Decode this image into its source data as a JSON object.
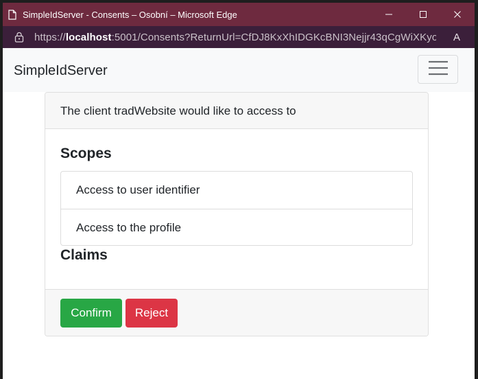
{
  "window": {
    "title": "SimpleIdServer - Consents – Osobní – Microsoft Edge",
    "colors": {
      "titlebar": "#6e2a3f",
      "addressbar": "#3b1f3a"
    }
  },
  "address_bar": {
    "url_prefix": "https://",
    "url_host": "localhost",
    "url_rest": ":5001/Consents?ReturnUrl=CfDJ8KxXhIDGKcBNI3Nejjr43qCgWiXKyo...",
    "read_aloud_label": "A"
  },
  "navbar": {
    "brand": "SimpleIdServer"
  },
  "consent": {
    "header": "The client tradWebsite would like to access to",
    "scopes_title": "Scopes",
    "scopes": [
      {
        "label": "Access to user identifier"
      },
      {
        "label": "Access to the profile"
      }
    ],
    "claims_title": "Claims",
    "confirm_label": "Confirm",
    "reject_label": "Reject",
    "colors": {
      "confirm": "#28a745",
      "reject": "#dc3545"
    }
  },
  "icons": {
    "page": "page-icon",
    "minimize": "minimize-icon",
    "maximize": "maximize-icon",
    "close": "close-icon",
    "lock": "lock-icon",
    "read_aloud": "read-aloud-icon",
    "menu": "hamburger-menu-icon"
  }
}
